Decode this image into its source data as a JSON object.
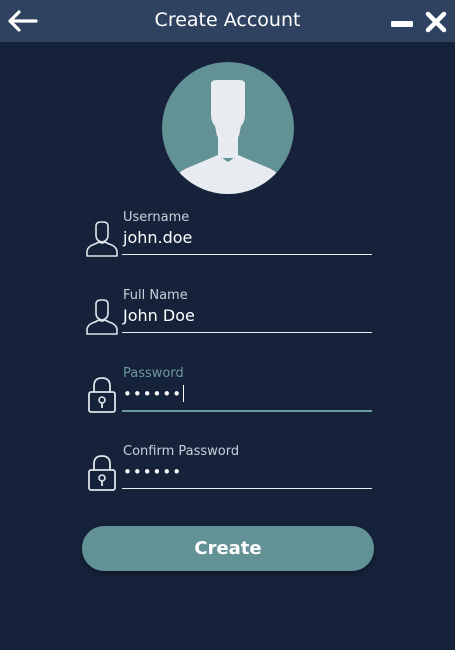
{
  "window": {
    "title": "Create Account",
    "back_icon": "arrow-left-icon",
    "minimize_icon": "minimize-icon",
    "close_icon": "close-icon"
  },
  "avatar": {
    "icon": "user-silhouette-icon",
    "circle_color": "#629196"
  },
  "form": {
    "username": {
      "label": "Username",
      "value": "john.doe",
      "icon": "user-icon"
    },
    "full_name": {
      "label": "Full Name",
      "value": "John Doe",
      "icon": "user-icon"
    },
    "password": {
      "label": "Password",
      "value": "••••••",
      "icon": "lock-icon",
      "focused": true
    },
    "confirm_password": {
      "label": "Confirm Password",
      "value": "••••••",
      "icon": "lock-icon"
    }
  },
  "actions": {
    "create_label": "Create"
  },
  "colors": {
    "background": "#15223a",
    "titlebar": "#2f4361",
    "accent": "#629196",
    "focus_label": "#6c9aa1"
  }
}
